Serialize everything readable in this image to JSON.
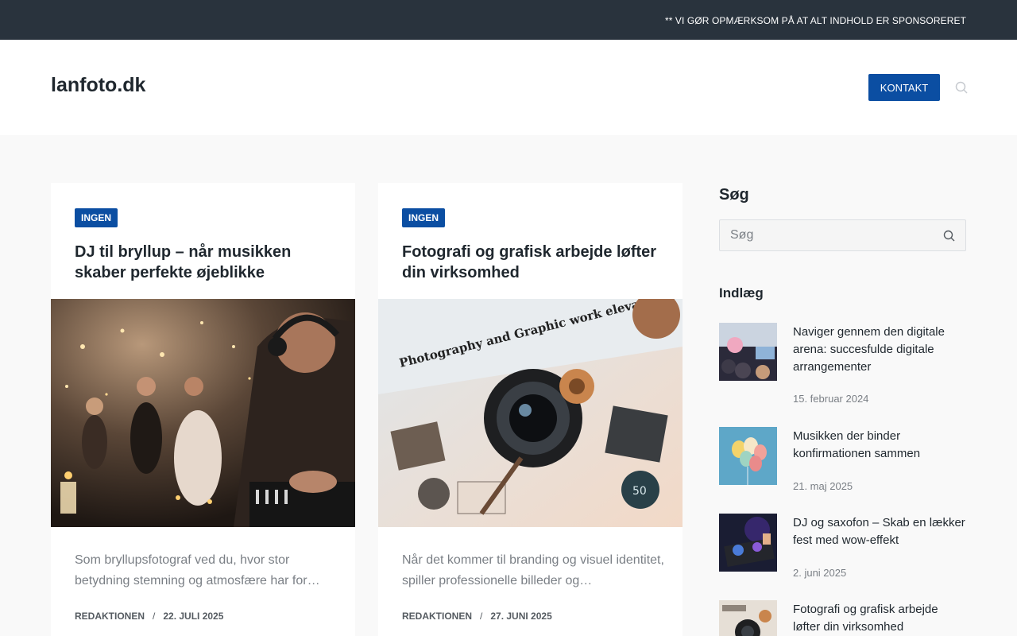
{
  "topbar": {
    "notice": "** VI GØR OPMÆRKSOM PÅ AT ALT INDHOLD ER SPONSORERET"
  },
  "header": {
    "site_title": "lanfoto.dk",
    "contact_label": "KONTAKT",
    "search_icon": "search-icon"
  },
  "posts": [
    {
      "category": "INGEN",
      "title": "DJ til bryllup – når musikken skaber perfekte øjeblikke",
      "excerpt": "Som bryllupsfotograf ved du, hvor stor betydning stemning og atmosfære har for…",
      "author": "REDAKTIONEN",
      "date": "22. JULI 2025"
    },
    {
      "category": "INGEN",
      "title": "Fotografi og grafisk arbejde løfter din virksomhed",
      "excerpt": "Når det kommer til branding og visuel identitet, spiller professionelle billeder og…",
      "author": "REDAKTIONEN",
      "date": "27. JUNI 2025",
      "image_text": "Photography and Graphic work elevates your business",
      "image_badge": "50"
    }
  ],
  "sidebar": {
    "search_title": "Søg",
    "search_placeholder": "Søg",
    "posts_title": "Indlæg",
    "recent": [
      {
        "title": "Naviger gennem den digitale arena: succesfulde digitale arrangementer",
        "date": "15. februar 2024"
      },
      {
        "title": "Musikken der binder konfirmationen sammen",
        "date": "21. maj 2025"
      },
      {
        "title": "DJ og saxofon – Skab en lækker fest med wow-effekt",
        "date": "2. juni 2025"
      },
      {
        "title": "Fotografi og grafisk arbejde løfter din virksomhed",
        "date": ""
      }
    ]
  },
  "colors": {
    "topbar": "#29333d",
    "accent": "#0b4ea2",
    "background": "#f9f9f9"
  }
}
